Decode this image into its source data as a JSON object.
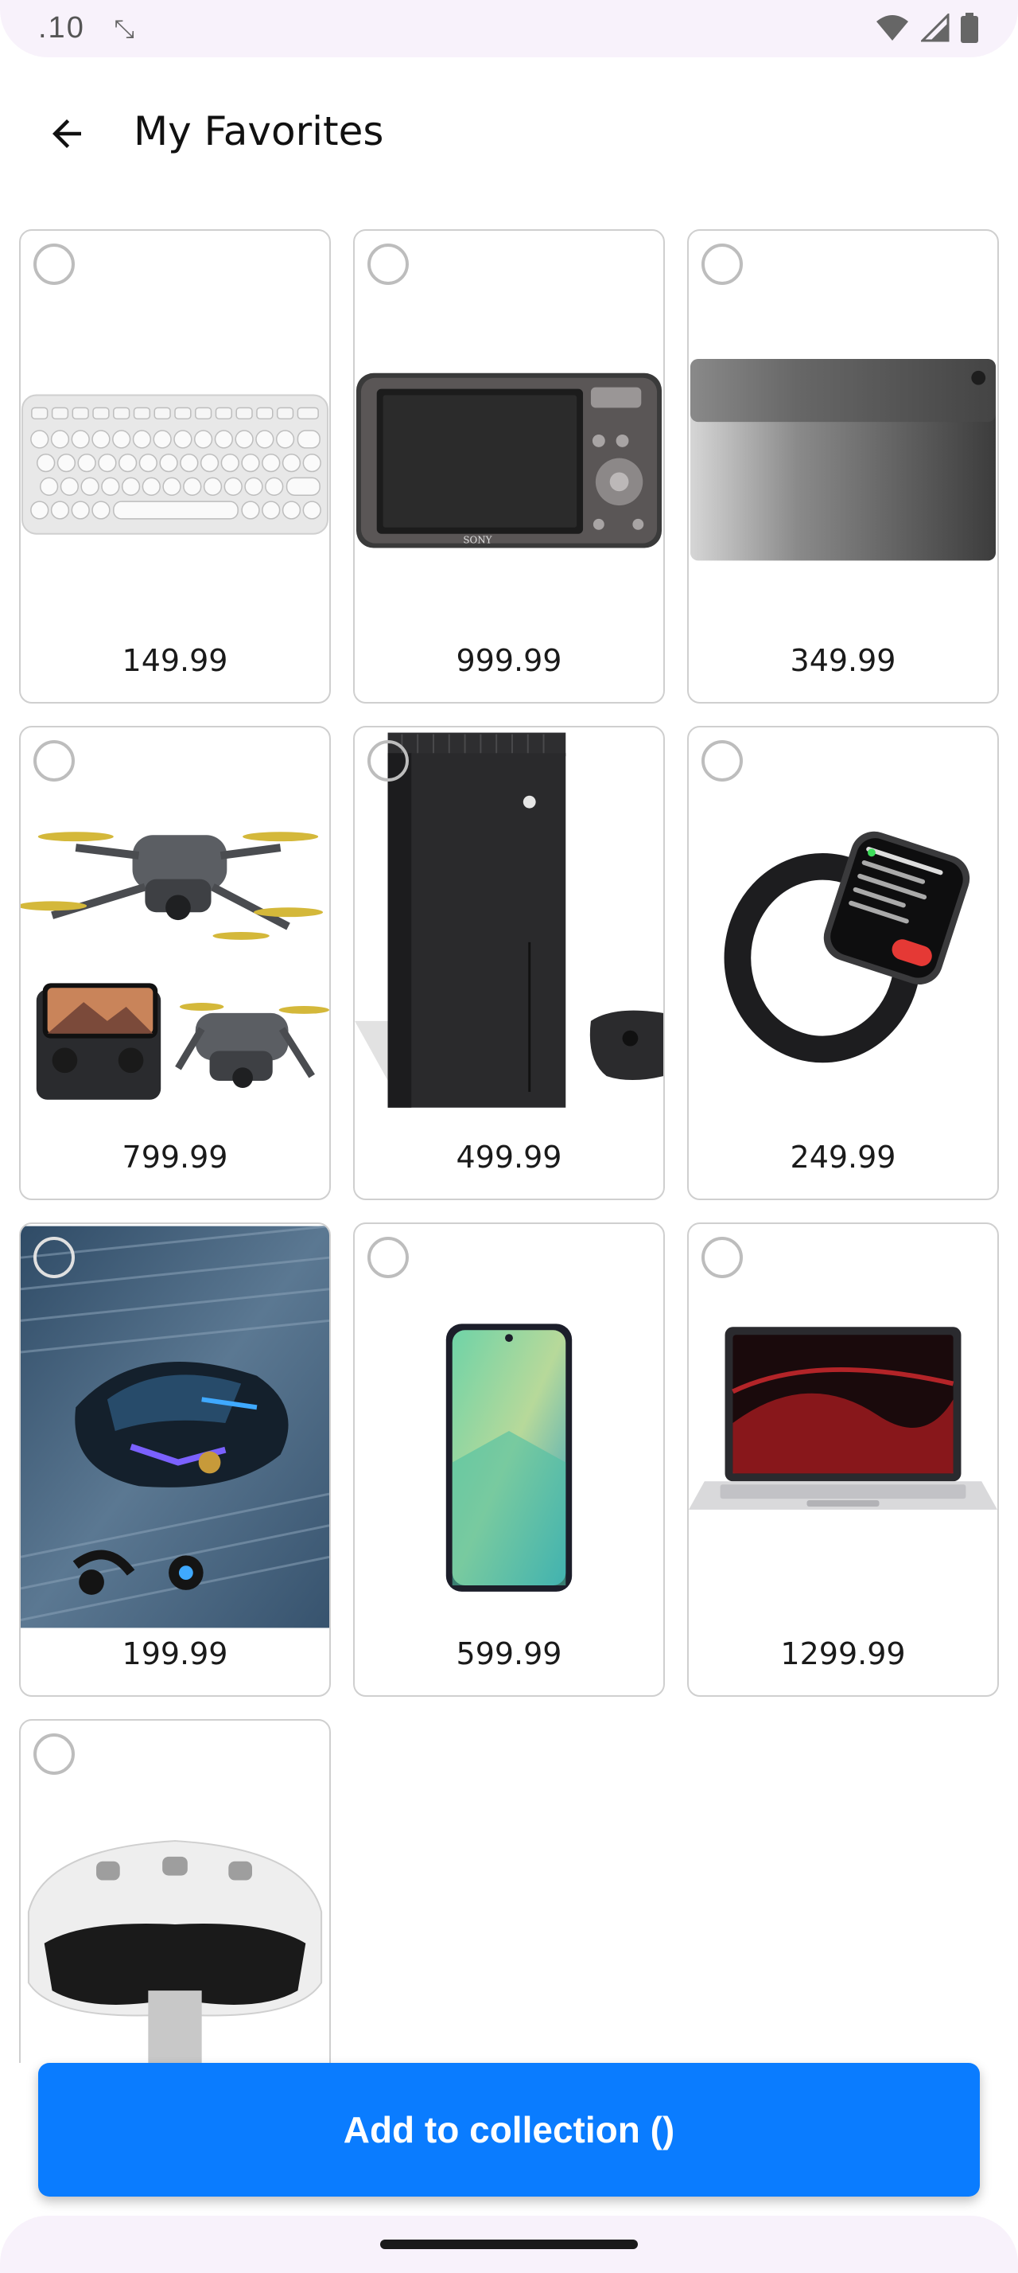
{
  "status_bar": {
    "left_text": ".10",
    "icons": [
      "screen-rotate-icon",
      "wifi-icon",
      "cellular-signal-icon",
      "battery-icon"
    ]
  },
  "header": {
    "title": "My Favorites",
    "back_icon": "arrow-back-icon"
  },
  "products": [
    {
      "price": "149.99",
      "image": "keyboard",
      "selected": false
    },
    {
      "price": "999.99",
      "image": "camera",
      "selected": false
    },
    {
      "price": "349.99",
      "image": "tablet",
      "selected": false
    },
    {
      "price": "799.99",
      "image": "drone",
      "selected": false
    },
    {
      "price": "499.99",
      "image": "game-console",
      "selected": false
    },
    {
      "price": "249.99",
      "image": "smartwatch",
      "selected": false
    },
    {
      "price": "199.99",
      "image": "gaming-mouse",
      "selected": false
    },
    {
      "price": "599.99",
      "image": "smartphone",
      "selected": false
    },
    {
      "price": "1299.99",
      "image": "laptop",
      "selected": false
    },
    {
      "price": "",
      "image": "vr-headset",
      "selected": false
    }
  ],
  "footer": {
    "cta_label": "Add to collection ()"
  },
  "colors": {
    "accent": "#0a7cff",
    "system_bar": "#f8f2fb",
    "card_border": "#cfcfcf",
    "radio_border": "#bdbdbd"
  }
}
